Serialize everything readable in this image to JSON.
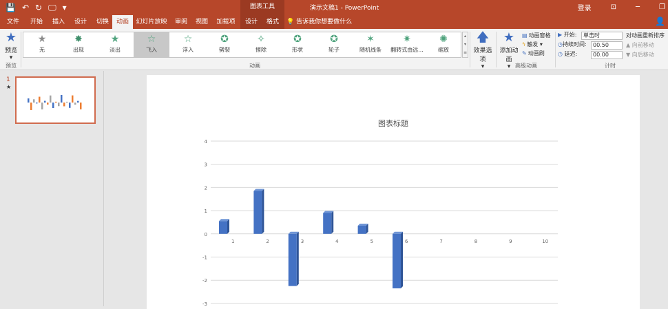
{
  "window": {
    "quick_access_symbols": [
      "💾",
      "↶",
      "↻",
      "🖵",
      "▾"
    ],
    "context_tools_label": "图表工具",
    "title": "演示文稿1  -  PowerPoint",
    "login": "登录",
    "controls": [
      "⊡",
      "─",
      "❐"
    ]
  },
  "tabs": [
    "文件",
    "开始",
    "插入",
    "设计",
    "切换",
    "动画",
    "幻灯片放映",
    "审阅",
    "视图",
    "加载项",
    "设计",
    "格式"
  ],
  "tell_me": "告诉我你想要做什么",
  "ribbon": {
    "preview": "预览",
    "preview_group": "预览",
    "animation_group": "动画",
    "advanced_group": "高级动画",
    "timing_group": "计时",
    "animations": [
      {
        "label": "无",
        "icon": "star-none-icon"
      },
      {
        "label": "出现",
        "icon": "star-appear-icon"
      },
      {
        "label": "淡出",
        "icon": "star-fade-icon"
      },
      {
        "label": "飞入",
        "icon": "star-fly-icon"
      },
      {
        "label": "浮入",
        "icon": "star-float-icon"
      },
      {
        "label": "劈裂",
        "icon": "star-split-icon"
      },
      {
        "label": "擦除",
        "icon": "star-wipe-icon"
      },
      {
        "label": "形状",
        "icon": "star-shape-icon"
      },
      {
        "label": "轮子",
        "icon": "star-wheel-icon"
      },
      {
        "label": "随机线条",
        "icon": "star-random-icon"
      },
      {
        "label": "翻转式由远...",
        "icon": "star-flip-icon"
      },
      {
        "label": "缩放",
        "icon": "star-zoom-icon"
      }
    ],
    "selected_animation": "飞入",
    "effect_options": "效果选项",
    "add_animation": "添加动画",
    "animation_pane": "动画窗格",
    "trigger": "触发",
    "animation_painter": "动画刷",
    "start_label": "开始:",
    "start_value": "单击时",
    "duration_label": "持续时间:",
    "duration_value": "00.50",
    "delay_label": "延迟:",
    "delay_value": "00.00",
    "reorder_title": "对动画重新排序",
    "move_earlier": "向前移动",
    "move_later": "向后移动"
  },
  "thumbs": {
    "slide_number": "1",
    "anim_marker": "★"
  },
  "chart_data": {
    "type": "bar",
    "title": "图表标题",
    "categories": [
      "1",
      "2",
      "3",
      "4",
      "5",
      "6",
      "7",
      "8",
      "9",
      "10"
    ],
    "values": [
      0.55,
      1.85,
      -2.25,
      0.9,
      0.35,
      -2.35,
      null,
      null,
      null,
      null
    ],
    "ylim": [
      -3,
      4
    ],
    "yticks": [
      "4",
      "3",
      "2",
      "1",
      "0",
      "-1",
      "-2",
      "-3"
    ],
    "grid": true,
    "colors": {
      "front": "#4472c4",
      "side": "#2f5597",
      "top": "#6f95d6"
    }
  }
}
